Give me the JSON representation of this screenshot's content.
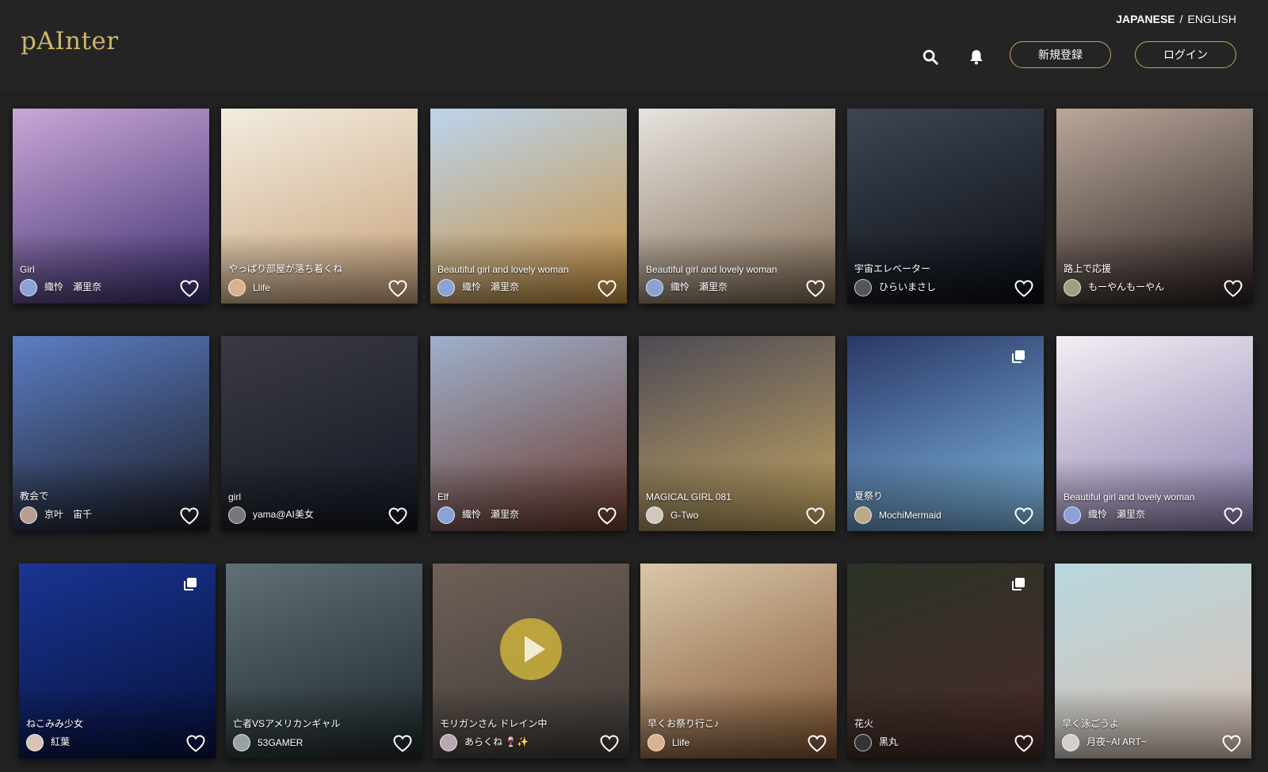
{
  "app": {
    "logo": "pAInter",
    "lang_active": "JAPANESE",
    "lang_sep": "/",
    "lang_other": "ENGLISH",
    "signup_label": "新規登録",
    "login_label": "ログイン",
    "accent_color": "#c9a94c"
  },
  "cards": [
    {
      "title": "Girl",
      "author": "織怜　瀬里奈",
      "bg": [
        "#c9a7d8",
        "#3c2e6e"
      ],
      "avatar": "#8aa2d6"
    },
    {
      "title": "やっぱり部屋が落ち着くね",
      "author": "Llife",
      "bg": [
        "#f2ecdf",
        "#c8a27a"
      ],
      "avatar": "#d9b28f"
    },
    {
      "title": "Beautiful girl and lovely woman",
      "author": "織怜　瀬里奈",
      "bg": [
        "#bcd4ec",
        "#c7903f"
      ],
      "avatar": "#8aa2d6"
    },
    {
      "title": "Beautiful girl and lovely woman",
      "author": "織怜　瀬里奈",
      "bg": [
        "#e7e3df",
        "#7f6a52"
      ],
      "avatar": "#8aa2d6"
    },
    {
      "title": "宇宙エレベーター",
      "author": "ひらいまさし",
      "bg": [
        "#3e4652",
        "#0a0d14"
      ],
      "avatar": "#555555"
    },
    {
      "title": "路上で応援",
      "author": "もーやんもーやん",
      "bg": [
        "#b9a89a",
        "#2b2020"
      ],
      "avatar": "#9aa37c"
    },
    {
      "title": "教会で",
      "author": "京叶　宙千",
      "bg": [
        "#5c7ec4",
        "#1b1b22"
      ],
      "avatar": "#b79f94"
    },
    {
      "title": "girl",
      "author": "yama@AI美女",
      "bg": [
        "#3a3a44",
        "#131722"
      ],
      "avatar": "#777777"
    },
    {
      "title": "Elf",
      "author": "織怜　瀬里奈",
      "bg": [
        "#9fb0cc",
        "#6b3a2c"
      ],
      "avatar": "#8aa2d6"
    },
    {
      "title": "MAGICAL GIRL 081",
      "author": "G-Two",
      "bg": [
        "#4d4a55",
        "#c4a663"
      ],
      "avatar": "#cfc8bd"
    },
    {
      "title": "夏祭り",
      "author": "MochiMermaid",
      "bg": [
        "#2a3768",
        "#7fb9e0"
      ],
      "avatar": "#bda987"
    },
    {
      "title": "Beautiful girl and lovely woman",
      "author": "織怜　瀬里奈",
      "bg": [
        "#f3eef4",
        "#8c7dad"
      ],
      "avatar": "#8aa2d6"
    },
    {
      "title": "ねこみみ少女",
      "author": "紅葉",
      "bg": [
        "#1a3592",
        "#06103a"
      ],
      "avatar": "#d8c4b4"
    },
    {
      "title": "亡者VSアメリカンギャル",
      "author": "53GAMER",
      "bg": [
        "#5f7076",
        "#1e272a"
      ],
      "avatar": "#9aa1a4"
    },
    {
      "title": "モリガンさん ドレイン中",
      "author": "あらくね 🍷✨",
      "bg": [
        "#6f6058",
        "#3e3a36"
      ],
      "avatar": "#b8a9b0"
    },
    {
      "title": "早くお祭り行こ♪",
      "author": "Llife",
      "bg": [
        "#d9c7a8",
        "#7e5333"
      ],
      "avatar": "#d9b28f"
    },
    {
      "title": "花火",
      "author": "黒丸",
      "bg": [
        "#2b3327",
        "#4b2a2a"
      ],
      "avatar": "#333333"
    },
    {
      "title": "早く泳ごうよ",
      "author": "月夜~AI ART~",
      "bg": [
        "#b8d7de",
        "#d8c0b3"
      ],
      "avatar": "#d5cfc8"
    }
  ]
}
